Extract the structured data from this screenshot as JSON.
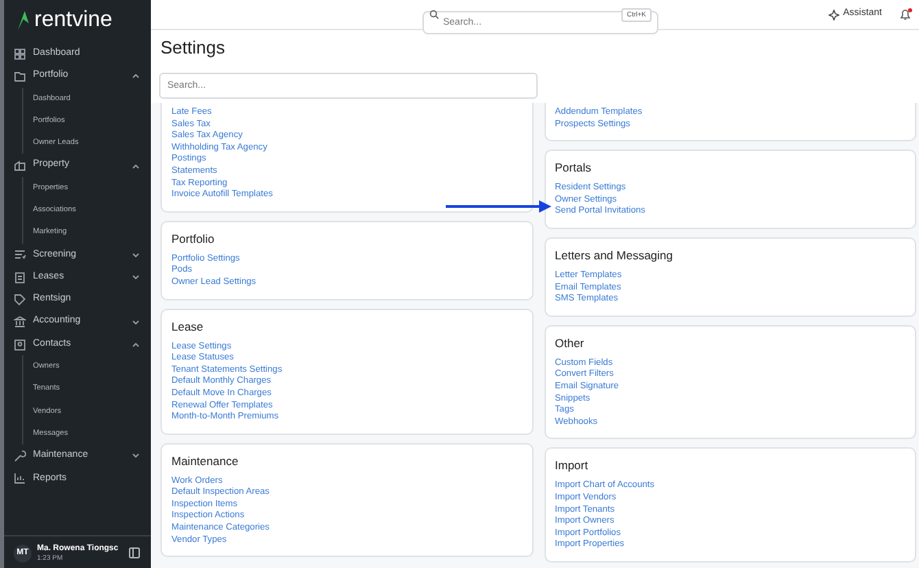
{
  "sidebar": {
    "logo": "rentvine",
    "items": [
      {
        "label": "Dashboard"
      },
      {
        "label": "Portfolio",
        "expanded": true,
        "children": [
          {
            "label": "Dashboard"
          },
          {
            "label": "Portfolios"
          },
          {
            "label": "Owner Leads"
          }
        ]
      },
      {
        "label": "Property",
        "expanded": true,
        "children": [
          {
            "label": "Properties"
          },
          {
            "label": "Associations"
          },
          {
            "label": "Marketing"
          }
        ]
      },
      {
        "label": "Screening",
        "expanded": false
      },
      {
        "label": "Leases",
        "expanded": false
      },
      {
        "label": "Rentsign"
      },
      {
        "label": "Accounting",
        "expanded": false
      },
      {
        "label": "Contacts",
        "expanded": true,
        "children": [
          {
            "label": "Owners"
          },
          {
            "label": "Tenants"
          },
          {
            "label": "Vendors"
          },
          {
            "label": "Messages"
          }
        ]
      },
      {
        "label": "Maintenance",
        "expanded": false
      },
      {
        "label": "Reports"
      }
    ],
    "user": {
      "initials": "MT",
      "name": "Ma. Rowena Tiongsc",
      "time": "1:23 PM"
    }
  },
  "top_bar": {
    "search": {
      "placeholder": "Search...",
      "shortcut": "Ctrl+K"
    },
    "assistant": "Assistant",
    "notifications": true
  },
  "page": {
    "title": "Settings",
    "search": {
      "placeholder": "Search..."
    }
  },
  "columns": [
    {
      "cards": [
        {
          "links": [
            "Late Fees",
            "Sales Tax",
            "Sales Tax Agency",
            "Withholding Tax Agency",
            "Postings",
            "Statements",
            "Tax Reporting",
            "Invoice Autofill Templates"
          ]
        },
        {
          "title": "Portfolio",
          "links": [
            "Portfolio Settings",
            "Pods",
            "Owner Lead Settings"
          ]
        },
        {
          "title": "Lease",
          "links": [
            "Lease Settings",
            "Lease Statuses",
            "Tenant Statements Settings",
            "Default Monthly Charges",
            "Default Move In Charges",
            "Renewal Offer Templates",
            "Month-to-Month Premiums"
          ]
        },
        {
          "title": "Maintenance",
          "links": [
            "Work Orders",
            "Default Inspection Areas",
            "Inspection Items",
            "Inspection Actions",
            "Maintenance Categories",
            "Vendor Types"
          ]
        }
      ]
    },
    {
      "cards": [
        {
          "links": [
            "Addendum Templates",
            "Prospects Settings"
          ]
        },
        {
          "title": "Portals",
          "links": [
            "Resident Settings",
            "Owner Settings",
            "Send Portal Invitations"
          ]
        },
        {
          "title": "Letters and Messaging",
          "links": [
            "Letter Templates",
            "Email Templates",
            "SMS Templates"
          ]
        },
        {
          "title": "Other",
          "links": [
            "Custom Fields",
            "Convert Filters",
            "Email Signature",
            "Snippets",
            "Tags",
            "Webhooks"
          ]
        },
        {
          "title": "Import",
          "links": [
            "Import Chart of Accounts",
            "Import Vendors",
            "Import Tenants",
            "Import Owners",
            "Import Portfolios",
            "Import Properties"
          ]
        }
      ]
    }
  ]
}
